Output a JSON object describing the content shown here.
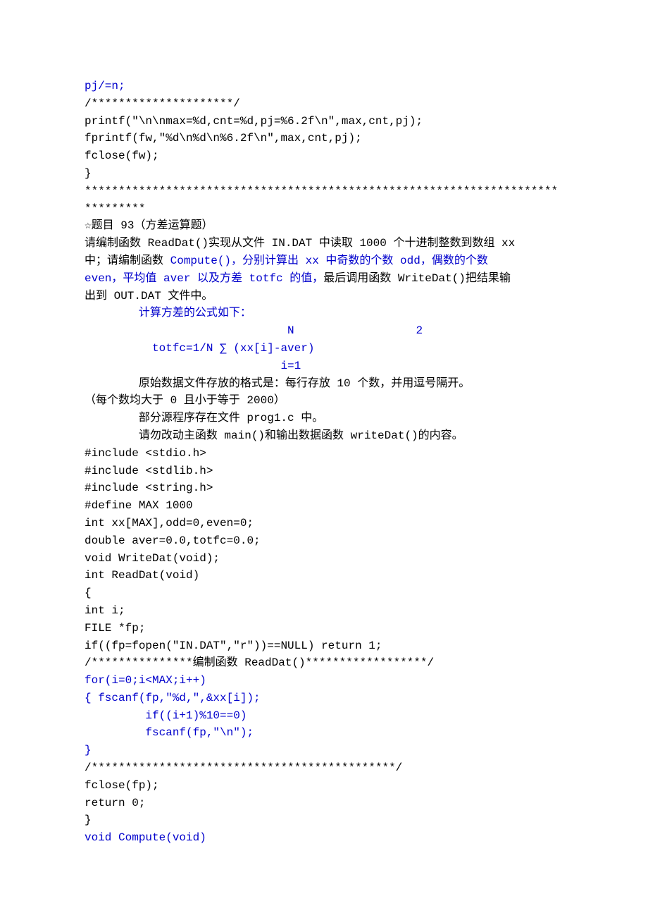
{
  "lines": [
    {
      "parts": [
        {
          "text": "pj/=n;",
          "cls": "blue"
        }
      ]
    },
    {
      "parts": [
        {
          "text": "/*********************/",
          "cls": "black"
        }
      ]
    },
    {
      "parts": [
        {
          "text": "printf(\"\\n\\nmax=%d,cnt=%d,pj=%6.2f\\n\",max,cnt,pj);",
          "cls": "black"
        }
      ]
    },
    {
      "parts": [
        {
          "text": "fprintf(fw,\"%d\\n%d\\n%6.2f\\n\",max,cnt,pj);",
          "cls": "black"
        }
      ]
    },
    {
      "parts": [
        {
          "text": "fclose(fw);",
          "cls": "black"
        }
      ]
    },
    {
      "parts": [
        {
          "text": "}",
          "cls": "black"
        }
      ]
    },
    {
      "parts": [
        {
          "text": "**********************************************************************",
          "cls": "black"
        }
      ]
    },
    {
      "parts": [
        {
          "text": "*********",
          "cls": "black"
        }
      ]
    },
    {
      "parts": [
        {
          "text": "☆题目 93（方差运算题）",
          "cls": "black"
        }
      ]
    },
    {
      "parts": [
        {
          "text": "请编制函数 ReadDat()实现从文件 IN.DAT 中读取 1000 个十进制整数到数组 xx",
          "cls": "black"
        }
      ]
    },
    {
      "parts": [
        {
          "text": "中；请编制函数 ",
          "cls": "black"
        },
        {
          "text": "Compute()，分别计算出 xx 中奇数的个数 odd，偶数的个数",
          "cls": "blue"
        }
      ]
    },
    {
      "parts": [
        {
          "text": "even，平均值 aver 以及方差 totfc 的值，",
          "cls": "blue"
        },
        {
          "text": "最后调用函数 WriteDat()把结果输",
          "cls": "black"
        }
      ]
    },
    {
      "parts": [
        {
          "text": "出到 OUT.DAT 文件中。",
          "cls": "black"
        }
      ]
    },
    {
      "parts": [
        {
          "text": "        计算方差的公式如下：",
          "cls": "blue"
        }
      ]
    },
    {
      "parts": [
        {
          "text": "                              N                  2",
          "cls": "blue"
        }
      ]
    },
    {
      "parts": [
        {
          "text": "          totfc=1/N ∑ (xx[i]-aver)",
          "cls": "blue"
        }
      ]
    },
    {
      "parts": [
        {
          "text": "                             i=1",
          "cls": "blue"
        }
      ]
    },
    {
      "parts": [
        {
          "text": "        原始数据文件存放的格式是：每行存放 10 个数，并用逗号隔开。",
          "cls": "black"
        }
      ]
    },
    {
      "parts": [
        {
          "text": "（每个数均大于 0 且小于等于 2000）",
          "cls": "black"
        }
      ]
    },
    {
      "parts": [
        {
          "text": "        部分源程序存在文件 prog1.c 中。",
          "cls": "black"
        }
      ]
    },
    {
      "parts": [
        {
          "text": "        请勿改动主函数 main()和输出数据函数 writeDat()的内容。",
          "cls": "black"
        }
      ]
    },
    {
      "parts": [
        {
          "text": "#include <stdio.h>",
          "cls": "black"
        }
      ]
    },
    {
      "parts": [
        {
          "text": "#include <stdlib.h>",
          "cls": "black"
        }
      ]
    },
    {
      "parts": [
        {
          "text": "#include <string.h>",
          "cls": "black"
        }
      ]
    },
    {
      "parts": [
        {
          "text": "#define MAX 1000",
          "cls": "black"
        }
      ]
    },
    {
      "parts": [
        {
          "text": "int xx[MAX],odd=0,even=0;",
          "cls": "black"
        }
      ]
    },
    {
      "parts": [
        {
          "text": "double aver=0.0,totfc=0.0;",
          "cls": "black"
        }
      ]
    },
    {
      "parts": [
        {
          "text": "void WriteDat(void);",
          "cls": "black"
        }
      ]
    },
    {
      "parts": [
        {
          "text": "int ReadDat(void)",
          "cls": "black"
        }
      ]
    },
    {
      "parts": [
        {
          "text": "{",
          "cls": "black"
        }
      ]
    },
    {
      "parts": [
        {
          "text": "int i;",
          "cls": "black"
        }
      ]
    },
    {
      "parts": [
        {
          "text": "FILE *fp;",
          "cls": "black"
        }
      ]
    },
    {
      "parts": [
        {
          "text": "if((fp=fopen(\"IN.DAT\",\"r\"))==NULL) return 1;",
          "cls": "black"
        }
      ]
    },
    {
      "parts": [
        {
          "text": "/***************编制函数 ReadDat()******************/",
          "cls": "black"
        }
      ]
    },
    {
      "parts": [
        {
          "text": "for(i=0;i<MAX;i++)",
          "cls": "blue"
        }
      ]
    },
    {
      "parts": [
        {
          "text": "{ fscanf(fp,\"%d,\",&xx[i]);",
          "cls": "blue"
        }
      ]
    },
    {
      "parts": [
        {
          "text": "         if((i+1)%10==0)",
          "cls": "blue"
        }
      ]
    },
    {
      "parts": [
        {
          "text": "         fscanf(fp,\"\\n\");",
          "cls": "blue"
        }
      ]
    },
    {
      "parts": [
        {
          "text": "}",
          "cls": "blue"
        }
      ]
    },
    {
      "parts": [
        {
          "text": "/*********************************************/",
          "cls": "black"
        }
      ]
    },
    {
      "parts": [
        {
          "text": "fclose(fp);",
          "cls": "black"
        }
      ]
    },
    {
      "parts": [
        {
          "text": "return 0;",
          "cls": "black"
        }
      ]
    },
    {
      "parts": [
        {
          "text": "}",
          "cls": "black"
        }
      ]
    },
    {
      "parts": [
        {
          "text": "void Compute(void)",
          "cls": "blue"
        }
      ]
    }
  ]
}
